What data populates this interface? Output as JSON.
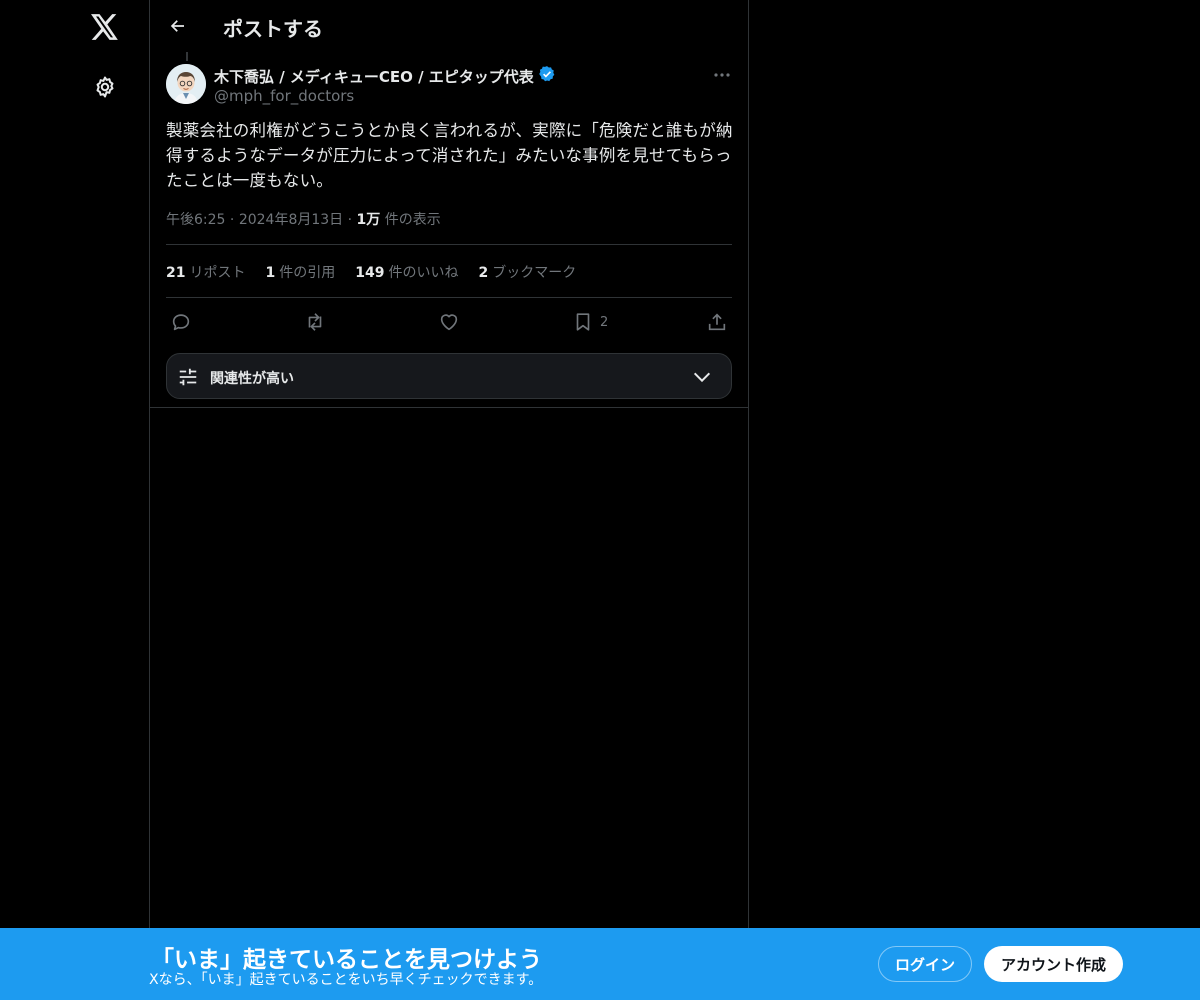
{
  "header": {
    "title": "ポストする"
  },
  "author": {
    "name": "木下喬弘 / メディキューCEO / エピタップ代表",
    "handle": "@mph_for_doctors"
  },
  "tweet": {
    "text": "製薬会社の利権がどうこうとか良く言われるが、実際に「危険だと誰もが納得するようなデータが圧力によって消された」みたいな事例を見せてもらったことは一度もない。",
    "time": "午後6:25",
    "date": "2024年8月13日",
    "views_count": "1万",
    "views_label": "件の表示"
  },
  "stats": [
    {
      "num": "21",
      "label": "リポスト"
    },
    {
      "num": "1",
      "label": "件の引用"
    },
    {
      "num": "149",
      "label": "件のいいね"
    },
    {
      "num": "2",
      "label": "ブックマーク"
    }
  ],
  "actions": {
    "bookmark_count": "2"
  },
  "relevance": {
    "label": "関連性が高い"
  },
  "banner": {
    "title": "「いま」起きていることを見つけよう",
    "subtitle": "Xなら、「いま」起きていることをいち早くチェックできます。",
    "login_label": "ログイン",
    "signup_label": "アカウント作成"
  },
  "colors": {
    "accent": "#1d9bf0",
    "background": "#000000",
    "muted": "#71767b",
    "verified": "#1d9bf0"
  },
  "icons": [
    "x-logo-icon",
    "gear-icon",
    "back-arrow-icon",
    "verified-icon",
    "more-icon",
    "reply-icon",
    "repost-icon",
    "like-icon",
    "bookmark-icon",
    "share-icon",
    "sliders-icon",
    "chevron-down-icon"
  ]
}
